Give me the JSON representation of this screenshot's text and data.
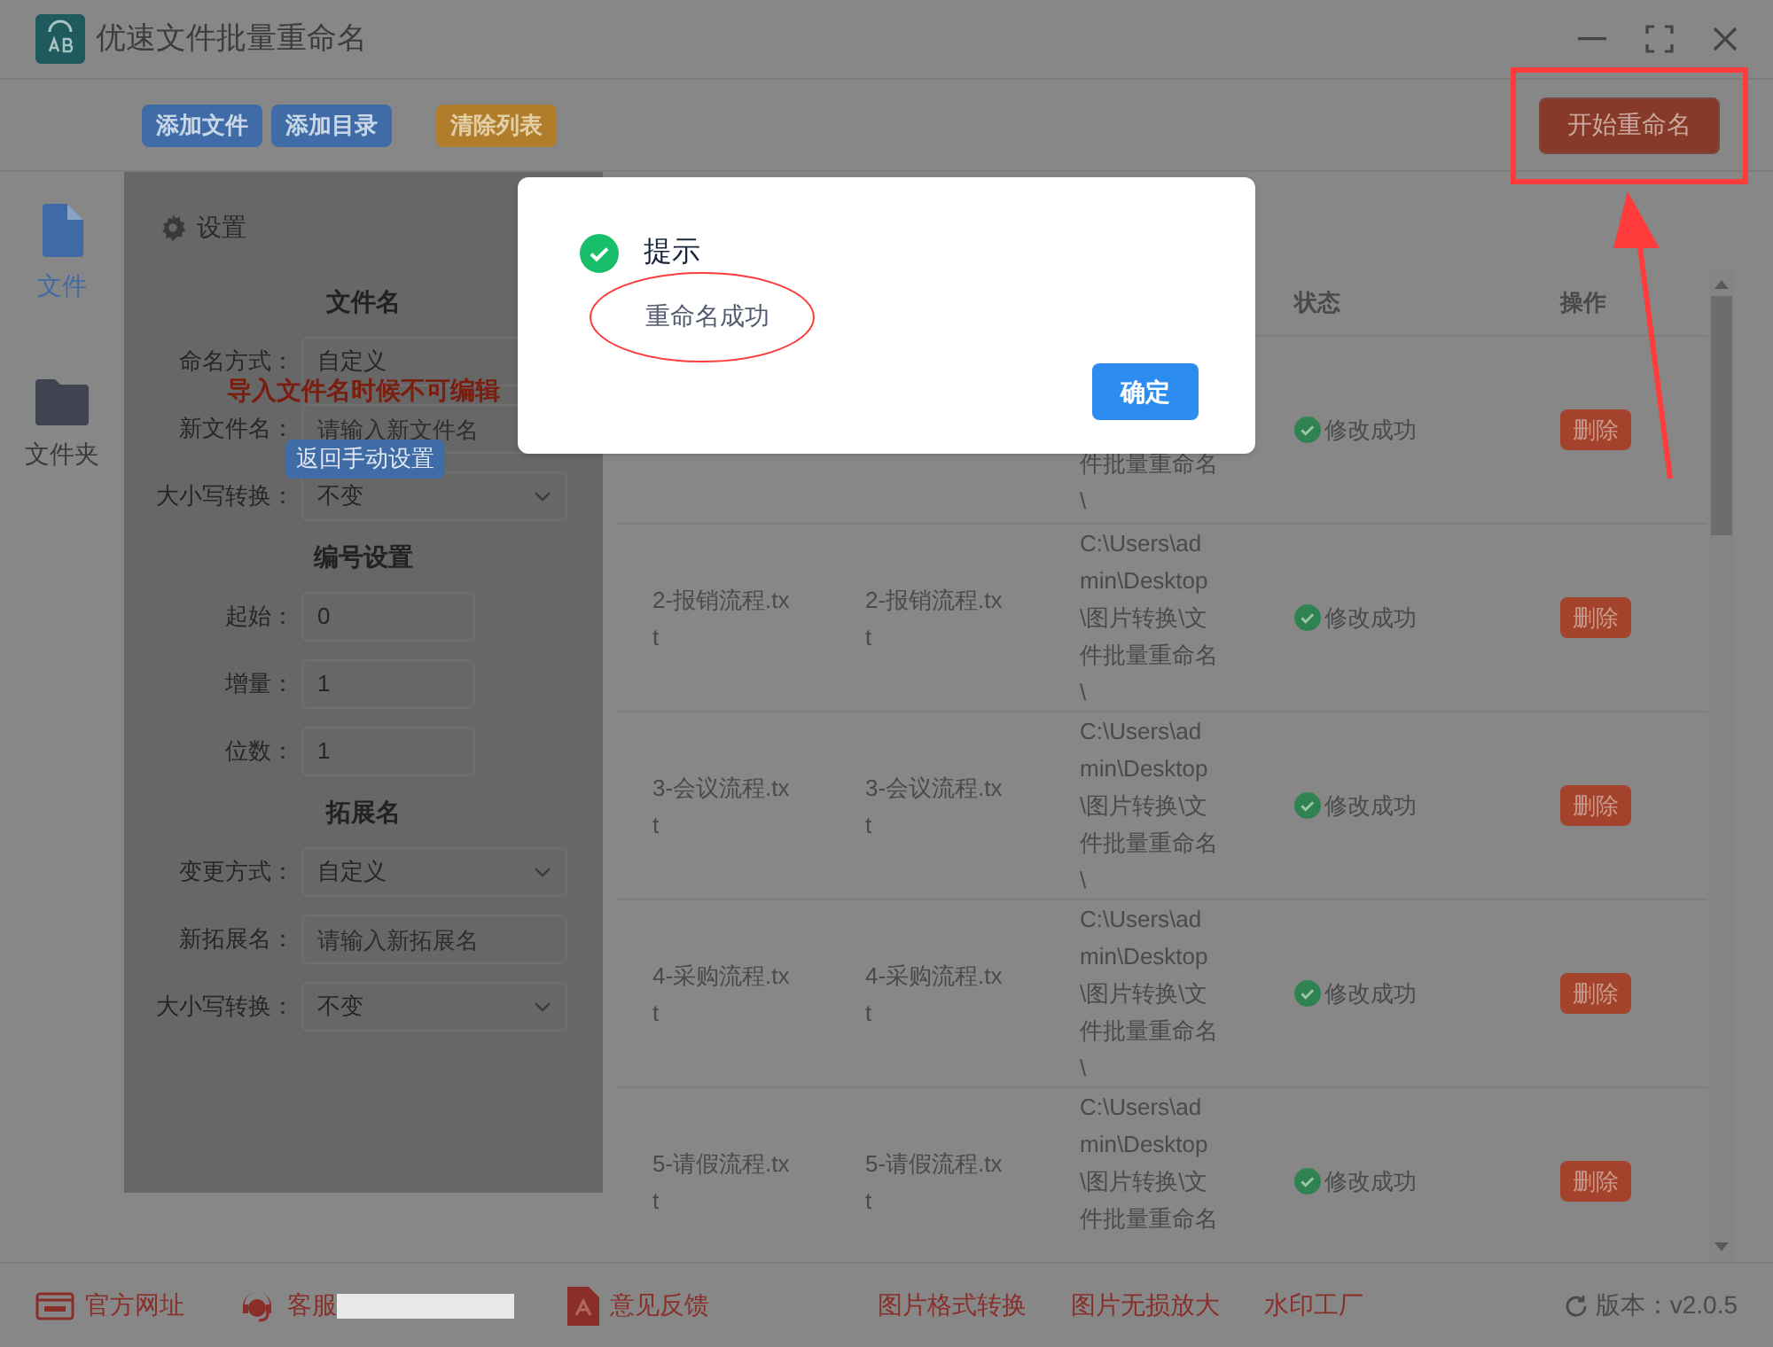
{
  "window": {
    "title": "优速文件批量重命名"
  },
  "toolbar": {
    "buttons": [
      {
        "label": "添加文件",
        "kind": "blue"
      },
      {
        "label": "添加目录",
        "kind": "blue"
      },
      {
        "label": "清除列表",
        "kind": "orange"
      }
    ],
    "start_button": "开始重命名"
  },
  "sidebar": {
    "items": [
      {
        "label": "文件",
        "kind": "file",
        "selected": true
      },
      {
        "label": "文件夹",
        "kind": "folder",
        "selected": false
      }
    ]
  },
  "settings": {
    "title": "设置",
    "locked_notice": "导入文件名时候不可编辑",
    "manual_button": "返回手动设置",
    "sections": [
      {
        "heading": "文件名",
        "fields": [
          {
            "label": "命名方式：",
            "kind": "value",
            "value": "自定义"
          },
          {
            "label": "新文件名：",
            "kind": "input",
            "placeholder": "请输入新文件名"
          },
          {
            "label": "大小写转换：",
            "kind": "select",
            "value": "不变"
          }
        ]
      },
      {
        "heading": "编号设置",
        "fields": [
          {
            "label": "起始：",
            "kind": "number",
            "value": "0"
          },
          {
            "label": "增量：",
            "kind": "number",
            "value": "1"
          },
          {
            "label": "位数：",
            "kind": "number",
            "value": "1"
          }
        ]
      },
      {
        "heading": "拓展名",
        "fields": [
          {
            "label": "变更方式：",
            "kind": "select",
            "value": "自定义"
          },
          {
            "label": "新拓展名：",
            "kind": "input",
            "placeholder": "请输入新拓展名"
          },
          {
            "label": "大小写转换：",
            "kind": "select",
            "value": "不变"
          }
        ]
      }
    ]
  },
  "table": {
    "header": {
      "status": "状态",
      "actions": "操作"
    },
    "rows": [
      {
        "path_lines": [
          "件批量重命名",
          "\\"
        ],
        "status": "修改成功",
        "success": true,
        "action": "删除"
      },
      {
        "column_1": [
          "2-报销流程.tx",
          "t"
        ],
        "column_2": [
          "2-报销流程.tx",
          "t"
        ],
        "path_lines": [
          "C:\\Users\\ad",
          "min\\Desktop",
          "\\图片转换\\文",
          "件批量重命名",
          "\\"
        ],
        "status": "修改成功",
        "success": true,
        "action": "删除"
      },
      {
        "column_1": [
          "3-会议流程.tx",
          "t"
        ],
        "column_2": [
          "3-会议流程.tx",
          "t"
        ],
        "path_lines": [
          "C:\\Users\\ad",
          "min\\Desktop",
          "\\图片转换\\文",
          "件批量重命名",
          "\\"
        ],
        "status": "修改成功",
        "success": true,
        "action": "删除"
      },
      {
        "column_1": [
          "4-采购流程.tx",
          "t"
        ],
        "column_2": [
          "4-采购流程.tx",
          "t"
        ],
        "path_lines": [
          "C:\\Users\\ad",
          "min\\Desktop",
          "\\图片转换\\文",
          "件批量重命名",
          "\\"
        ],
        "status": "修改成功",
        "success": true,
        "action": "删除"
      },
      {
        "column_1": [
          "5-请假流程.tx",
          "t"
        ],
        "column_2": [
          "5-请假流程.tx",
          "t"
        ],
        "path_lines": [
          "C:\\Users\\ad",
          "min\\Desktop",
          "\\图片转换\\文",
          "件批量重命名"
        ],
        "status": "修改成功",
        "success": true,
        "action": "删除"
      }
    ]
  },
  "footer": {
    "links": [
      {
        "label": "官方网址",
        "kind": "web"
      },
      {
        "label": "客服",
        "kind": "support"
      },
      {
        "label": "意见反馈",
        "kind": "feedback"
      }
    ],
    "tools": [
      "图片格式转换",
      "图片无损放大",
      "水印工厂"
    ],
    "version": "版本：v2.0.5"
  },
  "dialog": {
    "title": "提示",
    "message": "重命名成功",
    "ok": "确定"
  }
}
